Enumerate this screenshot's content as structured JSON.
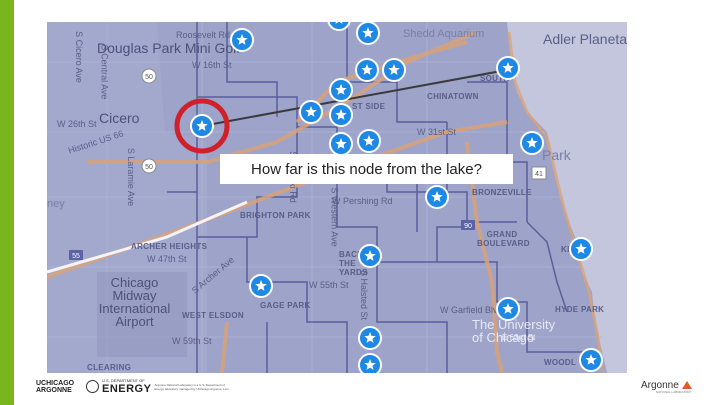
{
  "slide": {
    "question": "How far is this node from the lake?"
  },
  "map_labels": {
    "adler": "Adler Planetarium",
    "shedd": "Shedd Aquarium",
    "douglas": "Douglas Park Mini Golf",
    "roosevelt": "Roosevelt Rd",
    "w16th": "W 16th St",
    "cicero": "Cicero",
    "w26th": "W 26th St",
    "historic": "Historic US 66",
    "s_central": "S Central Ave",
    "s_laramie": "S Laramie Ave",
    "s_cicero": "S Cicero Ave",
    "w31st": "W 31st St",
    "park": "Park",
    "pershing": "W Pershing Rd",
    "bronzeville": "BRONZEVILLE",
    "brighton": "BRIGHTON PARK",
    "archer": "ARCHER HEIGHTS",
    "w47th": "W 47th St",
    "back_yards": "BACK OF THE YARDS",
    "w55th": "W 55th St",
    "grand_blvd": "GRAND BOULEVARD",
    "kenwood": "KEN",
    "chicago_airport": "Chicago Midway International Airport",
    "gage": "GAGE PARK",
    "west_elsdon": "WEST ELSDON",
    "w59th": "W 59th St",
    "garfield": "W Garfield Blvd",
    "hyde_park": "HYDE PARK",
    "university": "The University of Chicago",
    "e63rd": "E 63rd St",
    "woodlawn": "WOODL",
    "clearing": "CLEARING",
    "chinatown": "CHINATOWN",
    "south": "SOUTH",
    "west_side": "ST SIDE",
    "ney": "ney",
    "route50": "50",
    "route55": "55",
    "route41": "41",
    "route90": "90",
    "s_pulaski": "S Pulaski Rd",
    "s_western": "S Western Ave",
    "s_halsted": "S Halsted St",
    "s_archer": "S Archer Ave"
  },
  "footer": {
    "uchicago": "UCHICAGO",
    "argonne_llc": "ARGONNE",
    "us_dept": "U.S. DEPARTMENT OF",
    "energy": "ENERGY",
    "doe_note": "Argonne National Laboratory is a U.S. Department of Energy laboratory managed by UChicago Argonne, LLC.",
    "argonne": "Argonne",
    "argonne_sub": "NATIONAL LABORATORY"
  },
  "colors": {
    "accent_bar": "#7ab51d",
    "map_tint": "#9da3c9",
    "lake": "#c3c6dd",
    "marker": "#1e88e5",
    "highlight_ring": "#d0202a",
    "connector_line": "#3a3a3a",
    "highways": "#d9a27a"
  },
  "markers": {
    "count": 22,
    "icon": "star-marker-icon",
    "highlighted_icon": "circle-highlight-icon"
  }
}
